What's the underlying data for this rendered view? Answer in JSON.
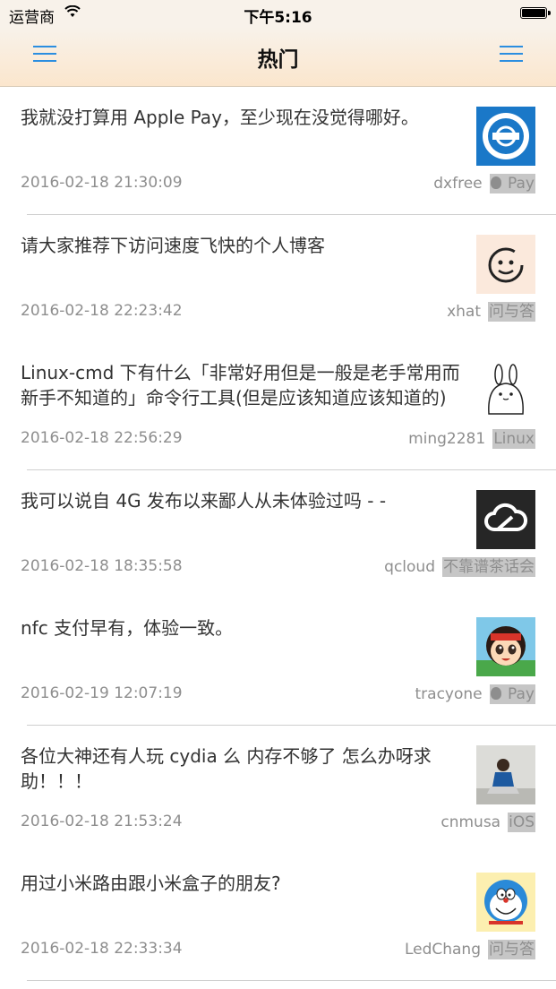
{
  "status_bar": {
    "carrier": "运营商",
    "time": "下午5:16"
  },
  "nav": {
    "title": "热门"
  },
  "topics": [
    {
      "title": "我就没打算用 Apple Pay，至少现在没觉得哪好。",
      "date": "2016-02-18 21:30:09",
      "user": "dxfree",
      "node": " Pay",
      "avatar": "badge-logo-icon",
      "divider": true
    },
    {
      "title": "请大家推荐下访问速度飞快的个人博客",
      "date": "2016-02-18 22:23:42",
      "user": "xhat",
      "node": "问与答",
      "avatar": "smiley-face-icon",
      "divider": false
    },
    {
      "title": "Linux-cmd 下有什么「非常好用但是一般是老手常用而新手不知道的」命令行工具(但是应该知道应该知道的)",
      "date": "2016-02-18 22:56:29",
      "user": "ming2281",
      "node": "Linux",
      "avatar": "bunny-icon",
      "divider": true
    },
    {
      "title": "我可以说自 4G 发布以来鄙人从未体验过吗 - -",
      "date": "2016-02-18 18:35:58",
      "user": "qcloud",
      "node": "不靠谱茶话会",
      "avatar": "cloud-icon",
      "divider": false
    },
    {
      "title": "nfc 支付早有，体验一致。",
      "date": "2016-02-19 12:07:19",
      "user": "tracyone",
      "node": " Pay",
      "avatar": "cartoon-girl-icon",
      "divider": true
    },
    {
      "title": "各位大神还有人玩 cydia 么 内存不够了 怎么办呀求助！！！",
      "date": "2016-02-18 21:53:24",
      "user": "cnmusa",
      "node": "iOS",
      "avatar": "photo-person-icon",
      "divider": false
    },
    {
      "title": "用过小米路由跟小米盒子的朋友?",
      "date": "2016-02-18 22:33:34",
      "user": "LedChang",
      "node": "问与答",
      "avatar": "doraemon-icon",
      "divider": true
    }
  ],
  "colors": {
    "accent": "#2b8ee0",
    "meta_text": "#8e8e8e",
    "node_bg": "#c6c6c6",
    "nav_bg": "#fbe6cd"
  }
}
